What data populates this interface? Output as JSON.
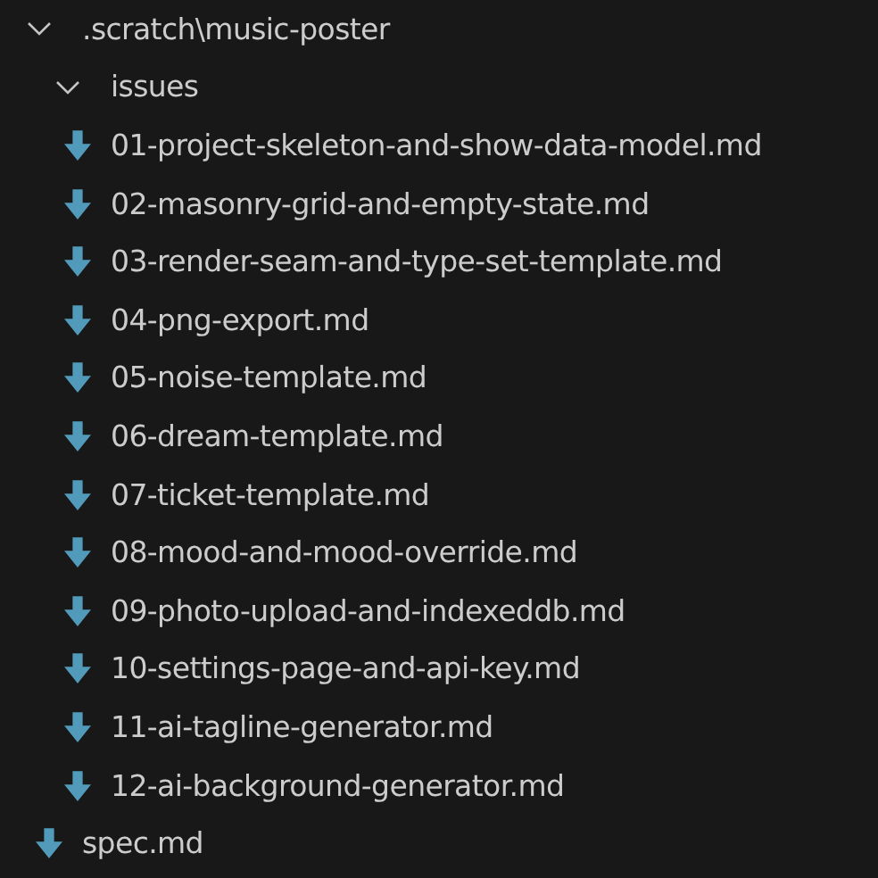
{
  "tree": [
    {
      "kind": "folder",
      "label": ".scratch\\music-poster",
      "expanded": true,
      "children": [
        {
          "kind": "folder",
          "label": "issues",
          "expanded": true,
          "children": [
            {
              "kind": "file",
              "label": "01-project-skeleton-and-show-data-model.md"
            },
            {
              "kind": "file",
              "label": "02-masonry-grid-and-empty-state.md"
            },
            {
              "kind": "file",
              "label": "03-render-seam-and-type-set-template.md"
            },
            {
              "kind": "file",
              "label": "04-png-export.md"
            },
            {
              "kind": "file",
              "label": "05-noise-template.md"
            },
            {
              "kind": "file",
              "label": "06-dream-template.md"
            },
            {
              "kind": "file",
              "label": "07-ticket-template.md"
            },
            {
              "kind": "file",
              "label": "08-mood-and-mood-override.md"
            },
            {
              "kind": "file",
              "label": "09-photo-upload-and-indexeddb.md"
            },
            {
              "kind": "file",
              "label": "10-settings-page-and-api-key.md"
            },
            {
              "kind": "file",
              "label": "11-ai-tagline-generator.md"
            },
            {
              "kind": "file",
              "label": "12-ai-background-generator.md"
            }
          ]
        },
        {
          "kind": "file",
          "label": "spec.md"
        }
      ]
    }
  ]
}
